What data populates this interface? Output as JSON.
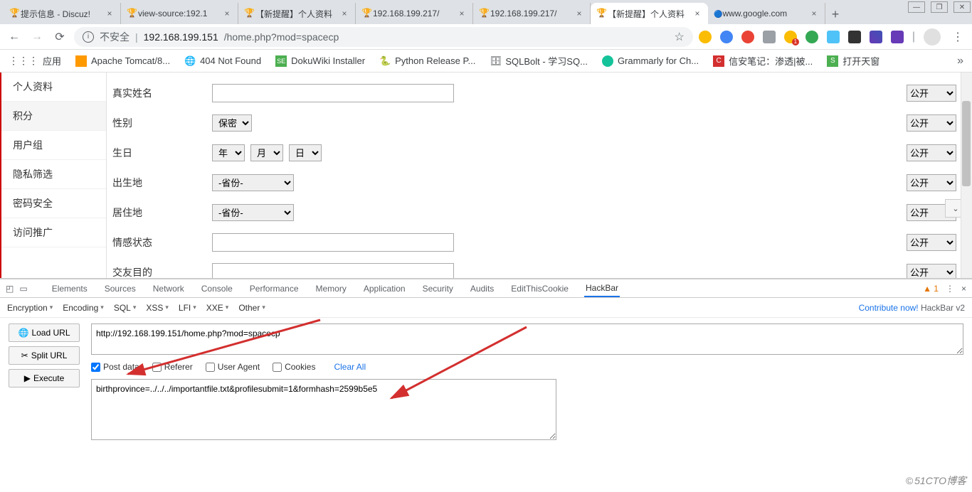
{
  "window_controls": {
    "minimize": "—",
    "maximize": "❐",
    "close": "✕"
  },
  "tabs": [
    {
      "title": "提示信息 - Discuz!",
      "favicon": "cup"
    },
    {
      "title": "view-source:192.1",
      "favicon": "cup"
    },
    {
      "title": "【新提醒】个人资料",
      "favicon": "cup"
    },
    {
      "title": "192.168.199.217/",
      "favicon": "cup"
    },
    {
      "title": "192.168.199.217/",
      "favicon": "cup"
    },
    {
      "title": "【新提醒】个人资料",
      "favicon": "cup",
      "active": true
    },
    {
      "title": "www.google.com",
      "favicon": "google"
    }
  ],
  "address": {
    "insecure_label": "不安全",
    "host": "192.168.199.151",
    "path": "/home.php?mod=spacecp"
  },
  "bookmarks": [
    {
      "label": "应用",
      "icon": "apps"
    },
    {
      "label": "Apache Tomcat/8...",
      "icon": "doc"
    },
    {
      "label": "404 Not Found",
      "icon": "globe"
    },
    {
      "label": "DokuWiki Installer",
      "icon": "se"
    },
    {
      "label": "Python Release P...",
      "icon": "py"
    },
    {
      "label": "SQLBolt - 学习SQ...",
      "icon": "db"
    },
    {
      "label": "Grammarly for Ch...",
      "icon": "gr"
    },
    {
      "label": "信安笔记：渗透|被...",
      "icon": "c"
    },
    {
      "label": "打开天窗",
      "icon": "s"
    }
  ],
  "sidebar": [
    "个人资料",
    "积分",
    "用户组",
    "隐私筛选",
    "密码安全",
    "访问推广"
  ],
  "form": {
    "rows": [
      {
        "label": "真实姓名",
        "type": "text",
        "privacy": "公开"
      },
      {
        "label": "性别",
        "type": "select",
        "value": "保密",
        "privacy": "公开"
      },
      {
        "label": "生日",
        "type": "date",
        "year": "年",
        "month": "月",
        "day": "日",
        "privacy": "公开"
      },
      {
        "label": "出生地",
        "type": "select-wide",
        "value": "-省份-",
        "privacy": "公开"
      },
      {
        "label": "居住地",
        "type": "select-wide",
        "value": "-省份-",
        "privacy": "公开"
      },
      {
        "label": "情感状态",
        "type": "text",
        "privacy": "公开"
      },
      {
        "label": "交友目的",
        "type": "text",
        "privacy": "公开"
      }
    ]
  },
  "devtools_tabs": [
    "Elements",
    "Sources",
    "Network",
    "Console",
    "Performance",
    "Memory",
    "Application",
    "Security",
    "Audits",
    "EditThisCookie",
    "HackBar"
  ],
  "devtools_active": "HackBar",
  "devtools_warn_count": "1",
  "hackbar": {
    "tools": [
      "Encryption",
      "Encoding",
      "SQL",
      "XSS",
      "LFI",
      "XXE",
      "Other"
    ],
    "contribute": "Contribute now!",
    "version": "HackBar v2",
    "buttons": {
      "load": "Load URL",
      "split": "Split URL",
      "execute": "Execute"
    },
    "url": "http://192.168.199.151/home.php?mod=spacecp",
    "options": {
      "post_data": {
        "label": "Post data",
        "checked": true
      },
      "referer": {
        "label": "Referer",
        "checked": false
      },
      "user_agent": {
        "label": "User Agent",
        "checked": false
      },
      "cookies": {
        "label": "Cookies",
        "checked": false
      },
      "clear_all": "Clear All"
    },
    "post_body": "birthprovince=../../../importantfile.txt&profilesubmit=1&formhash=2599b5e5"
  },
  "watermark": "51CTO博客"
}
